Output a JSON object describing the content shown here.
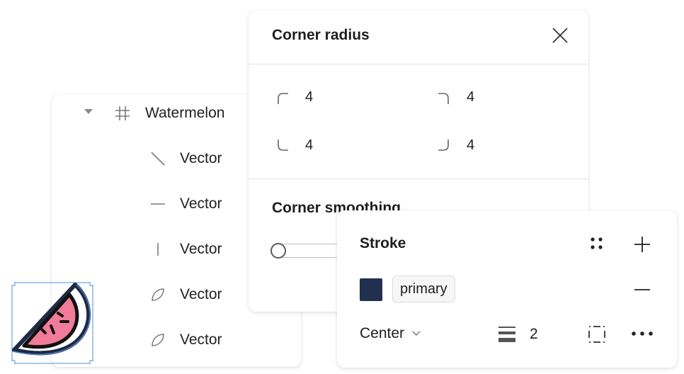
{
  "layers": {
    "frame_label": "Watermelon",
    "items": [
      {
        "label": "Vector",
        "icon": "diagonal-line-icon"
      },
      {
        "label": "Vector",
        "icon": "horizontal-line-icon"
      },
      {
        "label": "Vector",
        "icon": "vertical-line-icon"
      },
      {
        "label": "Vector",
        "icon": "curve-path-icon"
      },
      {
        "label": "Vector",
        "icon": "curve-path-icon"
      }
    ]
  },
  "corner_radius": {
    "title": "Corner radius",
    "top_left": "4",
    "top_right": "4",
    "bottom_left": "4",
    "bottom_right": "4",
    "smoothing_title": "Corner smoothing"
  },
  "stroke": {
    "title": "Stroke",
    "color_hex": "#21304f",
    "color_name": "primary",
    "position": "Center",
    "weight": "2"
  }
}
